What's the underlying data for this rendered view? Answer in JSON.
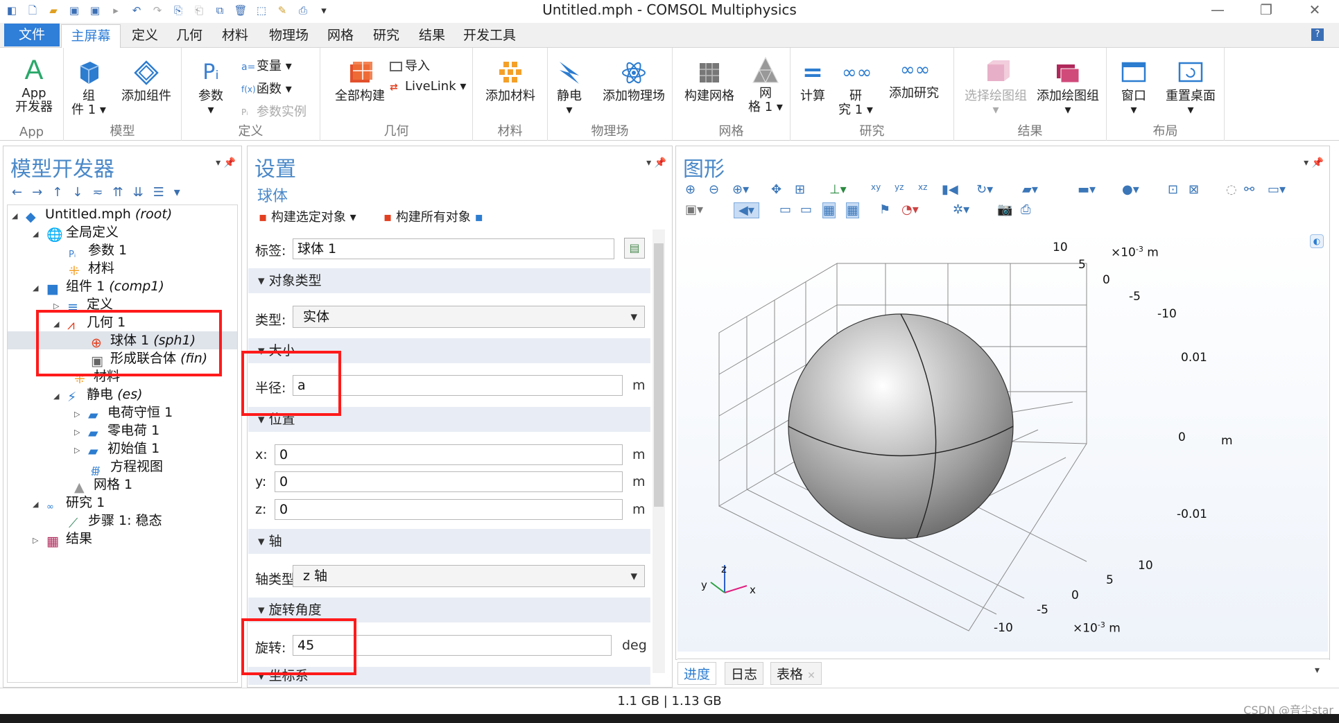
{
  "window": {
    "title": "Untitled.mph - COMSOL Multiphysics"
  },
  "menu": {
    "tabs": [
      "文件",
      "主屏幕",
      "定义",
      "几何",
      "材料",
      "物理场",
      "网格",
      "研究",
      "结果",
      "开发工具"
    ],
    "help": "?"
  },
  "ribbon": {
    "groups": {
      "app": "App",
      "model": "模型",
      "definitions": "定义",
      "geometry": "几何",
      "materials": "材料",
      "physics": "物理场",
      "mesh": "网格",
      "study": "研究",
      "results": "结果",
      "layout": "布局"
    },
    "buttons": {
      "app_builder_1": "App",
      "app_builder_2": "开发器",
      "component_1": "组",
      "component_2": "件 1",
      "add_component": "添加组件",
      "parameters": "参数",
      "variables": "变量",
      "functions": "函数",
      "param_case": "参数实例",
      "build_all": "全部构建",
      "import": "导入",
      "livelink": "LiveLink",
      "add_material": "添加材料",
      "electrostatics": "静电",
      "add_physics": "添加物理场",
      "build_mesh": "构建网格",
      "mesh_1a": "网",
      "mesh_1b": "格 1",
      "compute": "计算",
      "study_1a": "研",
      "study_1b": "究 1",
      "add_study": "添加研究",
      "select_plot": "选择绘图组",
      "add_plot": "添加绘图组",
      "windows": "窗口",
      "reset_desktop": "重置桌面"
    }
  },
  "model_builder": {
    "title": "模型开发器",
    "tree": {
      "root_name": "Untitled.mph",
      "root_tag": "(root)",
      "global": "全局定义",
      "params": "参数 1",
      "materials_global": "材料",
      "comp": "组件 1",
      "comp_tag": "(comp1)",
      "definitions": "定义",
      "geom": "几何 1",
      "sphere": "球体 1",
      "sphere_tag": "(sph1)",
      "union": "形成联合体",
      "union_tag": "(fin)",
      "materials": "材料",
      "es": "静电",
      "es_tag": "(es)",
      "charge": "电荷守恒 1",
      "zero_charge": "零电荷 1",
      "init": "初始值 1",
      "eq_view": "方程视图",
      "mesh": "网格 1",
      "study": "研究 1",
      "step": "步骤 1: 稳态",
      "results": "结果"
    }
  },
  "settings": {
    "title": "设置",
    "subtitle": "球体",
    "build_selected": "构建选定对象",
    "build_all": "构建所有对象",
    "label_lbl": "标签:",
    "label_val": "球体 1",
    "sec_object_type": "对象类型",
    "type_lbl": "类型:",
    "type_val": "实体",
    "sec_size": "大小",
    "radius_lbl": "半径:",
    "radius_val": "a",
    "unit_m": "m",
    "sec_position": "位置",
    "x_lbl": "x:",
    "x_val": "0",
    "y_lbl": "y:",
    "y_val": "0",
    "z_lbl": "z:",
    "z_val": "0",
    "sec_axis": "轴",
    "axis_type_lbl": "轴类型:",
    "axis_type_val": "z 轴",
    "sec_rotation": "旋转角度",
    "rotation_lbl": "旋转:",
    "rotation_val": "45",
    "unit_deg": "deg",
    "sec_coord": "坐标系"
  },
  "graphics": {
    "title": "图形",
    "axes": {
      "top_scale": "×10",
      "exp": "-3",
      "unit": "m",
      "top_ticks": [
        "10",
        "5",
        "0",
        "-5",
        "-10"
      ],
      "z_ticks": [
        "0.01",
        "0",
        "-0.01"
      ],
      "bottom_ticks": [
        "10",
        "5",
        "0",
        "-5",
        "-10"
      ],
      "triad": [
        "z",
        "y",
        "x"
      ]
    }
  },
  "bottom_tabs": [
    "进度",
    "日志",
    "表格"
  ],
  "status": {
    "memory": "1.1 GB | 1.13 GB",
    "watermark": "CSDN @音尘star"
  }
}
